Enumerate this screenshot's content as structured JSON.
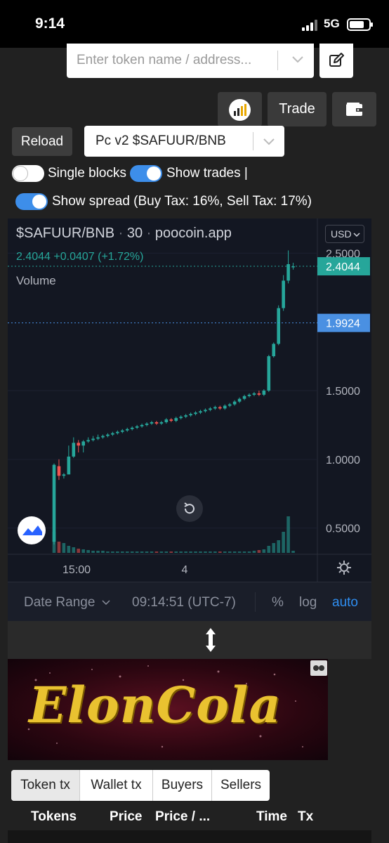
{
  "status_bar": {
    "time": "9:14",
    "network": "5G"
  },
  "search": {
    "placeholder": "Enter token name / address..."
  },
  "toolbar": {
    "trade_label": "Trade",
    "reload_label": "Reload"
  },
  "pair_select": {
    "value": "Pc v2 $SAFUUR/BNB"
  },
  "options": {
    "single_blocks": {
      "label": "Single blocks",
      "on": false
    },
    "show_trades": {
      "label": "Show trades |",
      "on": true
    },
    "show_spread": {
      "label": "Show spread (Buy Tax: 16%, Sell Tax: 17%)",
      "on": true
    }
  },
  "chart_header": {
    "symbol": "$SAFUUR/BNB",
    "sep1": "·",
    "interval": "30",
    "sep2": "·",
    "source": "poocoin.app",
    "last": "2.4044",
    "change": "+0.0407 (+1.72%)",
    "volume_label": "Volume",
    "currency": "USD"
  },
  "colors": {
    "up": "#26a69a",
    "down": "#ef5350",
    "accent": "#2f8ef0",
    "spread_line": "#4a90e2"
  },
  "chart_data": {
    "type": "candlestick",
    "title": "$SAFUUR/BNB",
    "ylim": [
      0.35,
      2.65
    ],
    "y_ticks": [
      2.5,
      1.5,
      1.0,
      0.5
    ],
    "y_tick_labels": [
      "2.5000",
      "1.5000",
      "1.0000",
      "0.5000"
    ],
    "x_tick_labels": [
      "15:00",
      "4"
    ],
    "price_labels": [
      {
        "value": 2.4044,
        "label": "2.4044",
        "color": "#26a69a"
      },
      {
        "value": 1.9924,
        "label": "1.9924",
        "color": "#4a90e2"
      }
    ],
    "candles": [
      [
        0.4,
        0.96,
        0.38,
        0.97
      ],
      [
        0.95,
        0.88,
        0.85,
        1.0
      ],
      [
        0.88,
        0.89,
        0.86,
        0.9
      ],
      [
        0.89,
        1.02,
        0.89,
        1.1
      ],
      [
        1.02,
        1.12,
        1.01,
        1.16
      ],
      [
        1.12,
        1.1,
        1.05,
        1.14
      ],
      [
        1.1,
        1.13,
        1.05,
        1.14
      ],
      [
        1.13,
        1.14,
        1.12,
        1.16
      ],
      [
        1.14,
        1.15,
        1.13,
        1.17
      ],
      [
        1.15,
        1.16,
        1.14,
        1.18
      ],
      [
        1.16,
        1.17,
        1.15,
        1.18
      ],
      [
        1.17,
        1.18,
        1.16,
        1.19
      ],
      [
        1.18,
        1.19,
        1.17,
        1.2
      ],
      [
        1.19,
        1.2,
        1.18,
        1.21
      ],
      [
        1.2,
        1.21,
        1.19,
        1.22
      ],
      [
        1.21,
        1.22,
        1.2,
        1.23
      ],
      [
        1.22,
        1.23,
        1.21,
        1.24
      ],
      [
        1.23,
        1.24,
        1.22,
        1.25
      ],
      [
        1.24,
        1.25,
        1.23,
        1.26
      ],
      [
        1.25,
        1.26,
        1.24,
        1.27
      ],
      [
        1.26,
        1.27,
        1.25,
        1.28
      ],
      [
        1.27,
        1.26,
        1.25,
        1.28
      ],
      [
        1.26,
        1.27,
        1.25,
        1.28
      ],
      [
        1.27,
        1.29,
        1.26,
        1.3
      ],
      [
        1.29,
        1.28,
        1.27,
        1.3
      ],
      [
        1.28,
        1.3,
        1.27,
        1.31
      ],
      [
        1.3,
        1.31,
        1.29,
        1.32
      ],
      [
        1.31,
        1.32,
        1.3,
        1.33
      ],
      [
        1.32,
        1.33,
        1.31,
        1.34
      ],
      [
        1.33,
        1.34,
        1.32,
        1.35
      ],
      [
        1.34,
        1.35,
        1.33,
        1.36
      ],
      [
        1.35,
        1.36,
        1.34,
        1.37
      ],
      [
        1.36,
        1.37,
        1.35,
        1.38
      ],
      [
        1.37,
        1.38,
        1.36,
        1.39
      ],
      [
        1.38,
        1.37,
        1.36,
        1.39
      ],
      [
        1.37,
        1.39,
        1.36,
        1.4
      ],
      [
        1.39,
        1.4,
        1.38,
        1.41
      ],
      [
        1.4,
        1.42,
        1.39,
        1.43
      ],
      [
        1.42,
        1.44,
        1.41,
        1.45
      ],
      [
        1.44,
        1.46,
        1.43,
        1.47
      ],
      [
        1.46,
        1.47,
        1.45,
        1.48
      ],
      [
        1.47,
        1.48,
        1.46,
        1.49
      ],
      [
        1.48,
        1.47,
        1.46,
        1.5
      ],
      [
        1.47,
        1.5,
        1.46,
        1.51
      ],
      [
        1.5,
        1.75,
        1.49,
        1.76
      ],
      [
        1.75,
        1.84,
        1.74,
        1.85
      ],
      [
        1.84,
        2.1,
        1.83,
        2.12
      ],
      [
        2.1,
        2.3,
        2.08,
        2.34
      ],
      [
        2.3,
        2.42,
        2.28,
        2.52
      ],
      [
        2.4,
        2.4044,
        2.38,
        2.43
      ]
    ],
    "volume": [
      30,
      16,
      14,
      10,
      8,
      6,
      5,
      4,
      3,
      3,
      3,
      2,
      2,
      2,
      2,
      2,
      2,
      2,
      2,
      2,
      2,
      2,
      2,
      2,
      2,
      2,
      2,
      2,
      2,
      2,
      2,
      2,
      2,
      2,
      2,
      2,
      2,
      2,
      2,
      2,
      2,
      3,
      4,
      5,
      10,
      14,
      18,
      30,
      52,
      3
    ]
  },
  "chart_footer": {
    "date_range": "Date Range",
    "time": "09:14:51 (UTC-7)",
    "percent": "%",
    "log": "log",
    "auto": "auto"
  },
  "banner": {
    "text": "ElonCola"
  },
  "tabs": [
    "Token tx",
    "Wallet tx",
    "Buyers",
    "Sellers"
  ],
  "table_headers": [
    "Tokens",
    "Price",
    "Price / ...",
    "Time",
    "Tx"
  ]
}
